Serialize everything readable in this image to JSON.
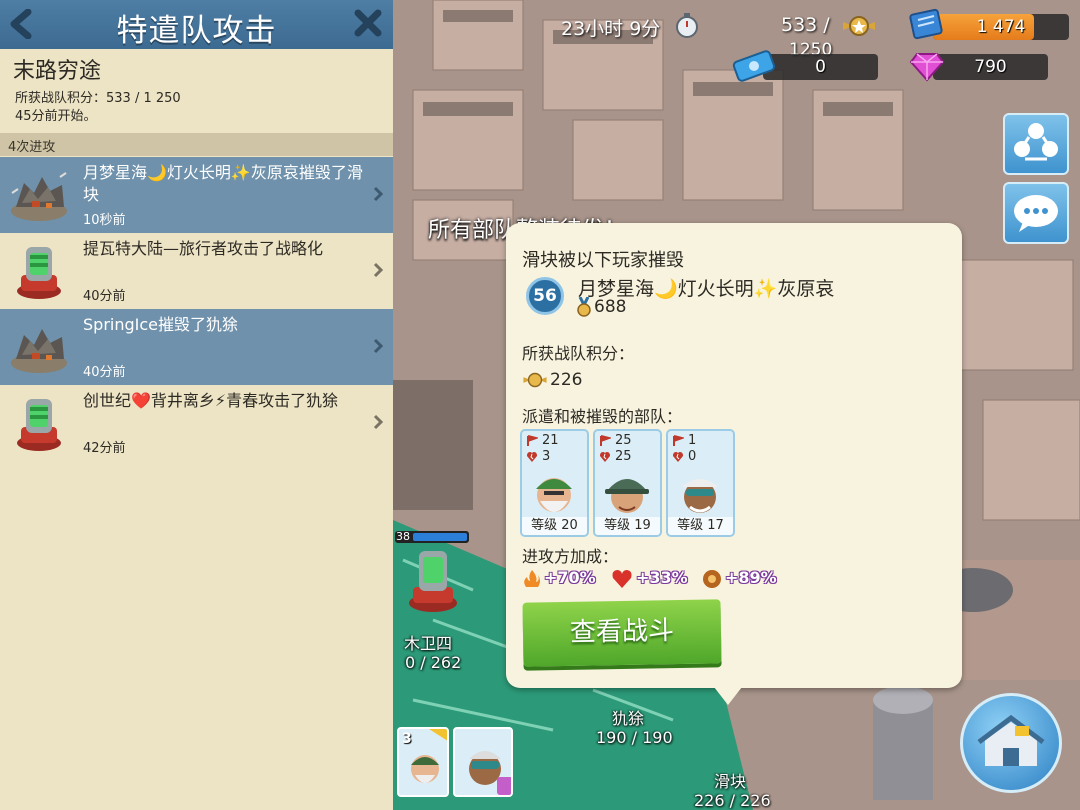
{
  "panel": {
    "title": "特遣队攻击",
    "operation_name": "末路穷途",
    "score_text": "所获战队积分：533 / 1 250",
    "started_text": "45分前开始。",
    "attack_count": "4次进攻",
    "attacks": [
      {
        "text": "月梦星海🌙灯火长明✨灰原哀摧毁了滑块",
        "time": "10秒前",
        "selected": true
      },
      {
        "text": "提瓦特大陆—旅行者攻击了战略化",
        "time": "40分前",
        "selected": false
      },
      {
        "text": "SpringIce摧毁了犰狳",
        "time": "40分前",
        "selected": true
      },
      {
        "text": "创世纪❤️背井离乡⚡青春攻击了犰狳",
        "time": "42分前",
        "selected": false
      }
    ]
  },
  "hud": {
    "timer": "23小时 9分",
    "score": "533 /",
    "score_max": "1250",
    "intel": "1 474",
    "tickets": "0",
    "diamonds": "790",
    "intel_fill": 0.74,
    "colors": {
      "gold": "#e7a33a",
      "diamond": "#d84ad0",
      "ticket": "#3b9fe0"
    }
  },
  "popup": {
    "notice": "所有部队整装待发！",
    "title": "滑块被以下玩家摧毁",
    "player_level": "56",
    "player_name": "月梦星海🌙灯火长明✨灰原哀",
    "player_medals": "688",
    "points_label": "所获战队积分：",
    "points_value": "226",
    "troops_label": "派遣和被摧毁的部队：",
    "troops": [
      {
        "deployed": "21",
        "lost": "3",
        "level": "等级 20"
      },
      {
        "deployed": "25",
        "lost": "25",
        "level": "等级 19"
      },
      {
        "deployed": "1",
        "lost": "0",
        "level": "等级 17"
      }
    ],
    "boost_label": "进攻方加成：",
    "boosts": [
      "+70%",
      "+33%",
      "+89%"
    ],
    "view_button": "查看战斗"
  },
  "world": {
    "label_muweisi": "木卫四",
    "muweisi_hp": "0 / 262",
    "label_qiuyu": "犰狳",
    "qiuyu_hp": "190 / 190",
    "label_huakuai": "滑块",
    "huakuai_hp": "226 / 226",
    "hp_level": "38",
    "troop_count": "3"
  }
}
